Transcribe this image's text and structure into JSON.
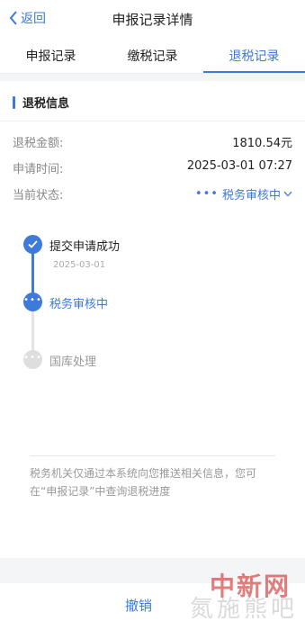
{
  "nav": {
    "back_label": "返回",
    "title": "申报记录详情"
  },
  "tabs": [
    {
      "label": "申报记录",
      "active": false
    },
    {
      "label": "缴税记录",
      "active": false
    },
    {
      "label": "退税记录",
      "active": true
    }
  ],
  "section": {
    "title": "退税信息"
  },
  "info": {
    "amount_label": "退税金额:",
    "amount_value": "1810.54元",
    "time_label": "申请时间:",
    "time_value": "2025-03-01 07:27",
    "status_label": "当前状态:",
    "status_value": "税务审核中"
  },
  "timeline": [
    {
      "label": "提交申请成功",
      "date": "2025-03-01",
      "state": "done"
    },
    {
      "label": "税务审核中",
      "date": "",
      "state": "active"
    },
    {
      "label": "国库处理",
      "date": "",
      "state": "pending"
    }
  ],
  "note": "税务机关仅通过本系统向您推送相关信息，您可在“申报记录”中查询退税进度",
  "bottom": {
    "cancel_label": "撤销"
  },
  "watermark": {
    "text": "中新网",
    "text2": "氮施熊吧"
  },
  "colors": {
    "accent": "#3d7ad9",
    "muted": "#999999",
    "pending_node": "#dedede"
  }
}
